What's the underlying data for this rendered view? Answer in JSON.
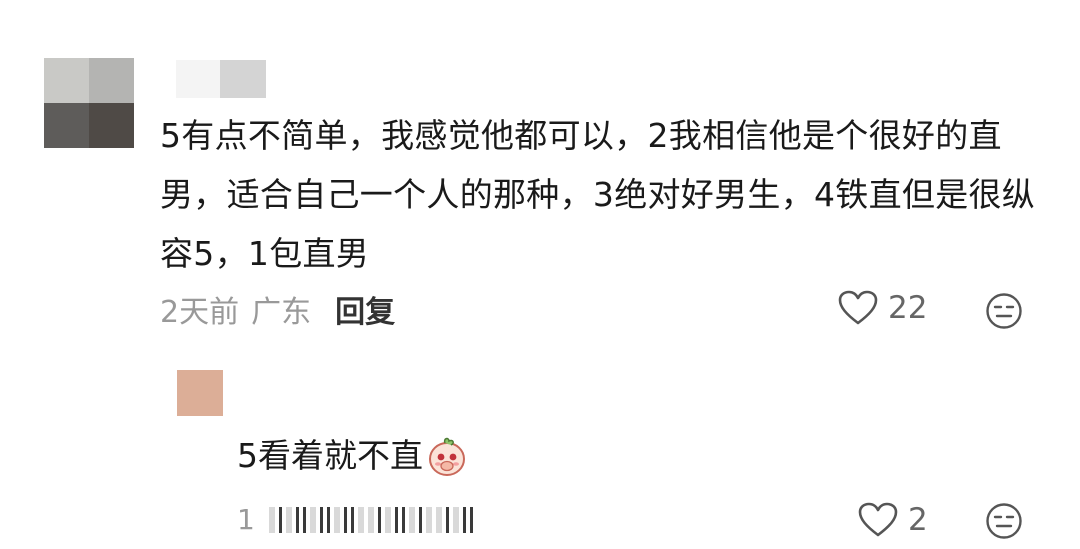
{
  "comment": {
    "text": "5有点不简单，我感觉他都可以，2我相信他是个很好的直男，适合自己一个人的那种，3绝对好男生，4铁直但是很纵容5，1包直男",
    "time": "2天前",
    "location": "广东",
    "reply_label": "回复",
    "like_count": "22"
  },
  "reply": {
    "text": "5看着就不直",
    "time_partial": "1",
    "like_count": "2"
  },
  "icons": {
    "like": "heart-outline-icon",
    "dislike": "neutral-face-icon",
    "emoji": "peach-emoji-icon"
  },
  "colors": {
    "meta_gray": "#999999",
    "reply_label": "#333333",
    "icon_stroke": "#555555"
  }
}
